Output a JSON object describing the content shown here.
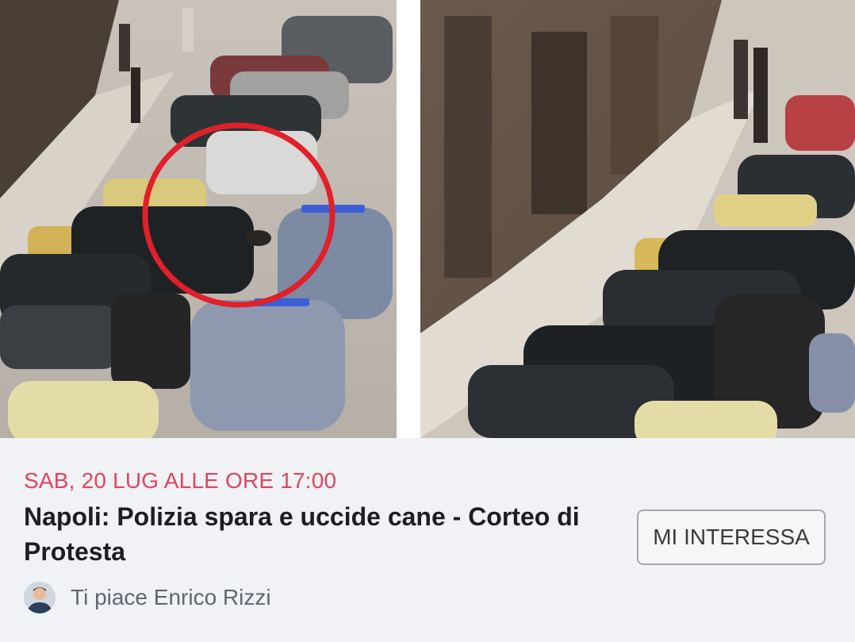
{
  "post": {
    "photo": {
      "left_panel_label": "street photo with red circle around police car and dog",
      "right_panel_label": "street photo close-up of parked cars",
      "highlight_color": "#e0202a"
    },
    "event": {
      "date_time": "SAB, 20 LUG ALLE ORE 17:00",
      "title": "Napoli: Polizia spara e uccide cane - Corteo di Protesta",
      "interest_button_label": "MI INTERESSA",
      "friends_text": "Ti piace Enrico Rizzi"
    },
    "colors": {
      "date_accent": "#e0455f",
      "title_text": "#1c1e21",
      "secondary_text": "#606770",
      "button_border": "#a4a7ab",
      "background": "#f0f2f5"
    },
    "icons": {
      "avatar": "person-avatar"
    }
  }
}
